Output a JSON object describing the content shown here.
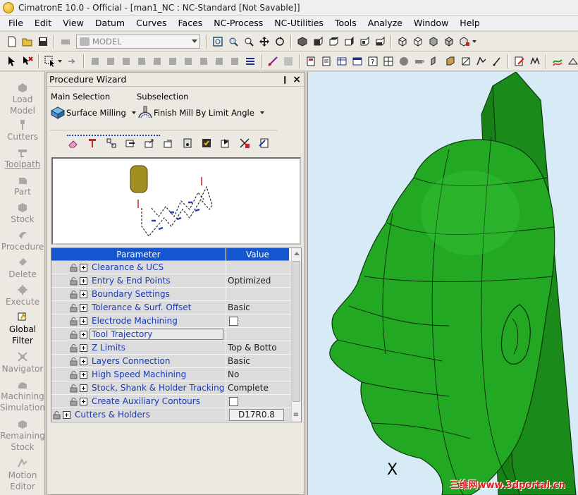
{
  "window": {
    "title": "CimatronE 10.0 - Official - [man1_NC : NC-Standard [Not Savable]]"
  },
  "menu": [
    "File",
    "Edit",
    "View",
    "Datum",
    "Curves",
    "Faces",
    "NC-Process",
    "NC-Utilities",
    "Tools",
    "Analyze",
    "Window",
    "Help"
  ],
  "toolbar": {
    "model_combo": "MODEL"
  },
  "sidebar": {
    "items": [
      {
        "label": "Load\nModel",
        "icon": "load-model-icon",
        "active": false
      },
      {
        "label": "Cutters",
        "icon": "cutters-icon",
        "active": false
      },
      {
        "label": "Toolpath",
        "icon": "toolpath-icon",
        "active": false
      },
      {
        "label": "Part",
        "icon": "part-icon",
        "active": false
      },
      {
        "label": "Stock",
        "icon": "stock-icon",
        "active": false
      },
      {
        "label": "Procedure",
        "icon": "procedure-icon",
        "active": false
      },
      {
        "label": "Delete",
        "icon": "delete-icon",
        "active": false
      },
      {
        "label": "Execute",
        "icon": "execute-icon",
        "active": false
      },
      {
        "label": "Global\nFilter",
        "icon": "global-filter-icon",
        "active": true
      },
      {
        "label": "Navigator",
        "icon": "navigator-icon",
        "active": false
      },
      {
        "label": "Machining\nSimulation",
        "icon": "machining-simulation-icon",
        "active": false
      },
      {
        "label": "Remaining\nStock",
        "icon": "remaining-stock-icon",
        "active": false
      },
      {
        "label": "Motion\nEditor",
        "icon": "motion-editor-icon",
        "active": false
      }
    ]
  },
  "wizard": {
    "title": "Procedure Wizard",
    "pin": "‖",
    "close": "×",
    "main_selection_label": "Main Selection",
    "subselection_label": "Subselection",
    "main_selection_value": "Surface Milling",
    "subselection_value": "Finish Mill By Limit Angle",
    "table": {
      "col_parameter": "Parameter",
      "col_value": "Value",
      "rows": [
        {
          "label": "Clearance & UCS",
          "value": "",
          "type": "text"
        },
        {
          "label": "Entry & End Points",
          "value": "Optimized",
          "type": "text"
        },
        {
          "label": "Boundary Settings",
          "value": "",
          "type": "text"
        },
        {
          "label": "Tolerance & Surf. Offset",
          "value": "Basic",
          "type": "text"
        },
        {
          "label": "Electrode Machining",
          "value": "",
          "type": "checkbox"
        },
        {
          "label": "Tool Trajectory",
          "value": "",
          "type": "text",
          "selected": true
        },
        {
          "label": "Z Limits",
          "value": "Top & Botto",
          "type": "text"
        },
        {
          "label": "Layers Connection",
          "value": "Basic",
          "type": "text"
        },
        {
          "label": "High Speed Machining",
          "value": "No",
          "type": "text"
        },
        {
          "label": "Stock, Shank & Holder Tracking",
          "value": "Complete",
          "type": "text"
        },
        {
          "label": "Create Auxiliary Contours",
          "value": "",
          "type": "checkbox"
        }
      ],
      "footer_row": {
        "label": "Cutters & Holders",
        "value": "D17R0.8"
      }
    }
  },
  "viewport": {
    "axis_label": "X",
    "watermark": "三维网www.3dportal.cn",
    "model_color": "#1fa01f",
    "background": "#d7ebf7"
  }
}
